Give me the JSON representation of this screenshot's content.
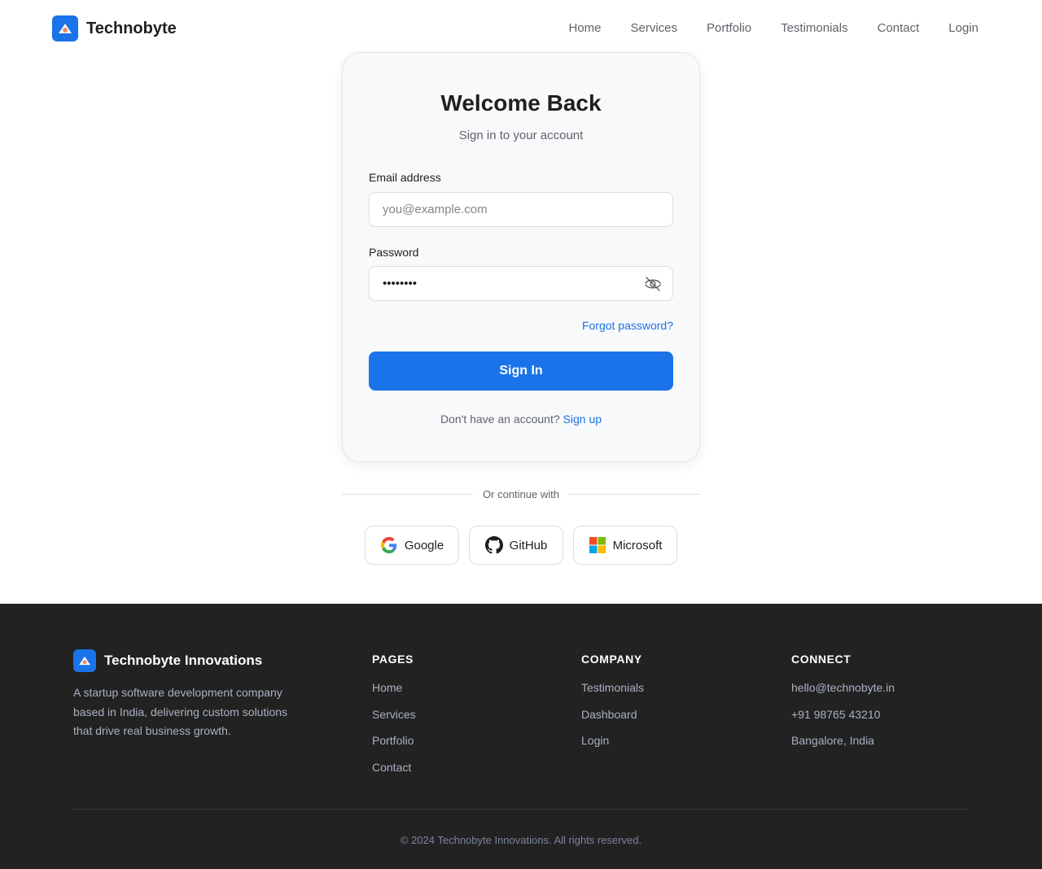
{
  "brand": {
    "name": "Technobyte",
    "color": "#1a73e8"
  },
  "nav": {
    "items": [
      "Home",
      "Services",
      "Portfolio",
      "Testimonials",
      "Contact",
      "Login"
    ]
  },
  "login": {
    "title": "Welcome Back",
    "subtitle": "Sign in to your account",
    "email_label": "Email address",
    "email_placeholder": "you@example.com",
    "password_label": "Password",
    "password_value": "••••••••",
    "toggle_icon": "eye-off-icon",
    "forgot": "Forgot password?",
    "submit": "Sign In",
    "no_account": "Don't have an account?",
    "signup": "Sign up"
  },
  "divider": "Or continue with",
  "social": [
    {
      "label": "Google",
      "icon": "google-icon"
    },
    {
      "label": "GitHub",
      "icon": "github-icon"
    },
    {
      "label": "Microsoft",
      "icon": "microsoft-icon"
    }
  ],
  "footer": {
    "brand_name": "Technobyte Innovations",
    "description": "A startup software development company based in India, delivering custom solutions that drive real business growth.",
    "pages": {
      "heading": "PAGES",
      "links": [
        "Home",
        "Services",
        "Portfolio",
        "Contact"
      ]
    },
    "company": {
      "heading": "COMPANY",
      "links": [
        "Testimonials",
        "Dashboard",
        "Login"
      ]
    },
    "connect": {
      "heading": "CONNECT",
      "links": [
        "hello@technobyte.in",
        "+91 98765 43210",
        "Bangalore, India"
      ]
    },
    "copyright": "© 2024 Technobyte Innovations. All rights reserved."
  }
}
